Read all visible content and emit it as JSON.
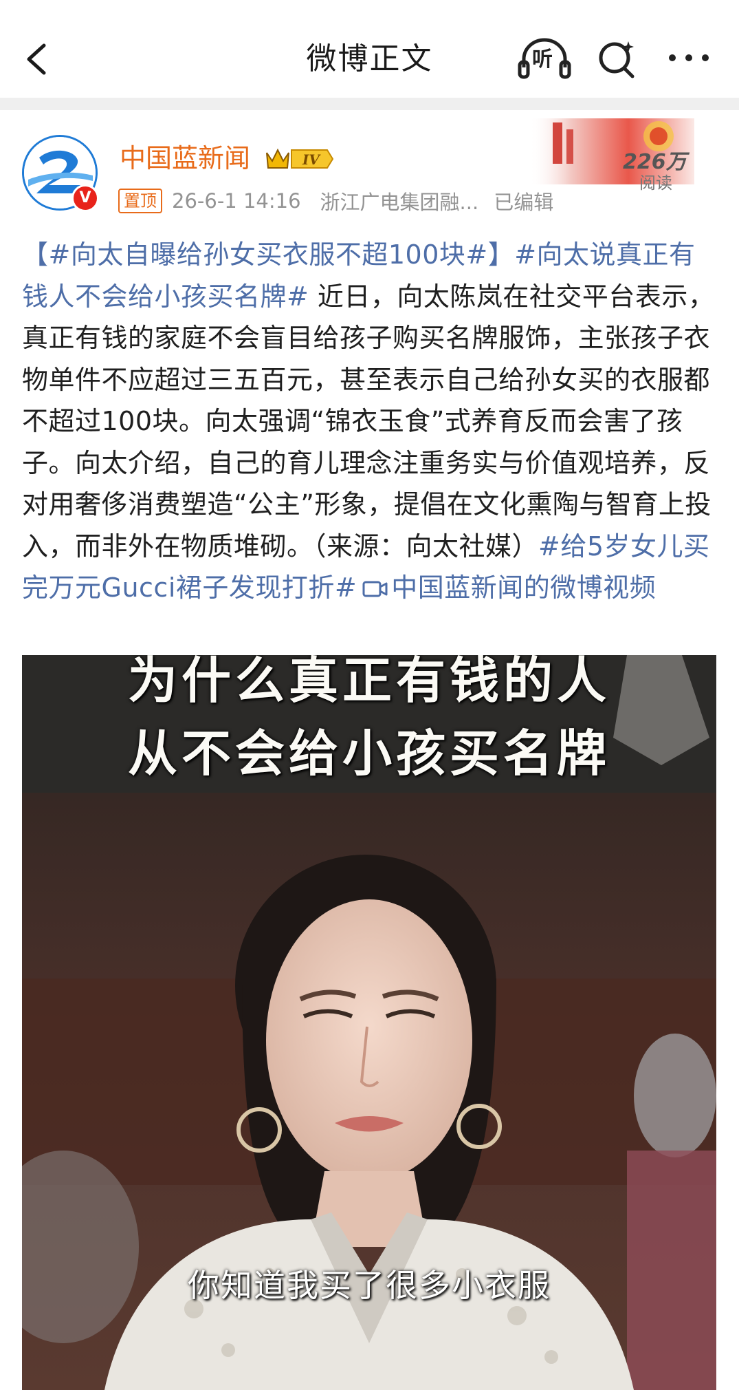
{
  "nav": {
    "title": "微博正文",
    "listen_label": "听"
  },
  "author": {
    "name": "中国蓝新闻",
    "badge": "IV",
    "pin_label": "置顶",
    "time": "26-6-1 14:16",
    "source": "浙江广电集团融...",
    "edited": "已编辑",
    "read_count": "226万",
    "read_label": "阅读"
  },
  "post": {
    "tag1": "【#向太自曝给孙女买衣服不超100块#】",
    "tag2": "#向太说真正有钱人不会给小孩买名牌#",
    "body": " 近日，向太陈岚在社交平台表示，真正有钱的家庭不会盲目给孩子购买名牌服饰，主张孩子衣物单件不应超过三五百元，甚至表示自己给孙女买的衣服都不超过100块。向太强调“锦衣玉食”式养育反而会害了孩子。向太介绍，自己的育儿理念注重务实与价值观培养，反对用奢侈消费塑造“公主”形象，提倡在文化熏陶与智育上投入，而非外在物质堆砌。（来源：向太社媒）",
    "tag3": "#给5岁女儿买完万元Gucci裙子发现打折#",
    "video_link": "中国蓝新闻的微博视频"
  },
  "video": {
    "title_line1": "为什么真正有钱的人",
    "title_line2": "从不会给小孩买名牌",
    "subtitle": "你知道我买了很多小衣服"
  },
  "colors": {
    "accent_orange": "#e86b1a",
    "link_blue": "#4e6ea8",
    "verified_red": "#e8231b"
  },
  "icons": [
    "back-arrow-icon",
    "headphones-icon",
    "search-icon",
    "more-icon",
    "crown-icon",
    "video-camera-icon"
  ]
}
